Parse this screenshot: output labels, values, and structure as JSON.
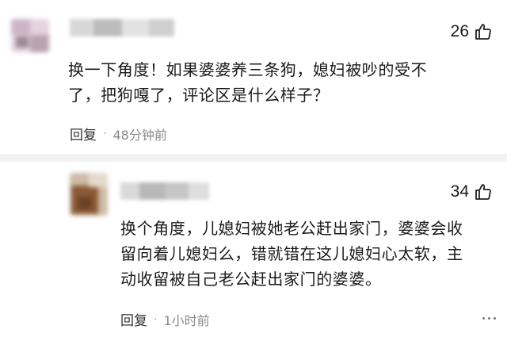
{
  "comments": [
    {
      "likes": "26",
      "text_lines": [
        "换一下角度！如果婆婆养三条狗，媳妇被吵的受不",
        "了，把狗嘎了，评论区是什么样子？"
      ],
      "reply_label": "回复",
      "separator": "·",
      "time": "48分钟前"
    },
    {
      "likes": "34",
      "text_lines": [
        "换个角度，儿媳妇被她老公赶出家门，婆婆会收",
        "留向着儿媳妇么，错就错在这儿媳妇心太软，主",
        "动收留被自己老公赶出家门的婆婆。"
      ],
      "reply_label": "回复",
      "separator": "·",
      "time": "1小时前"
    }
  ],
  "icons": {
    "like": "thumbs-up-icon",
    "more": "more-icon"
  },
  "colors": {
    "text": "#1a1a1a",
    "meta": "#8a8a8a",
    "divider": "#f2f2f2"
  }
}
